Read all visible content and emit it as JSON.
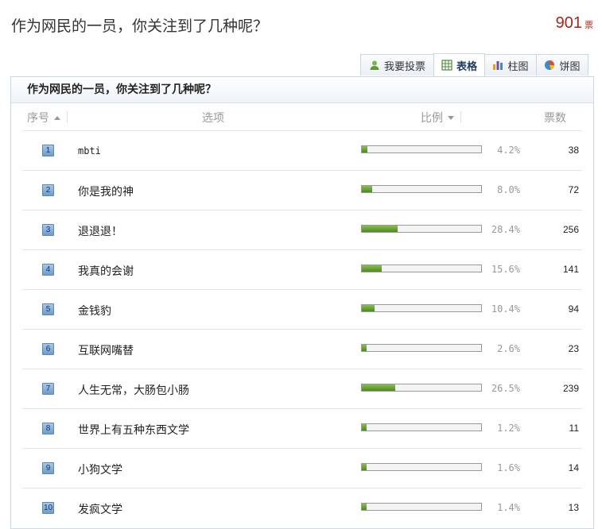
{
  "question": {
    "title": "作为网民的一员，你关注到了几种呢？",
    "total_votes": "901",
    "votes_unit": "票"
  },
  "tabs": [
    {
      "label": "我要投票",
      "icon": "user-icon",
      "active": false
    },
    {
      "label": "表格",
      "icon": "table-icon",
      "active": true
    },
    {
      "label": "柱图",
      "icon": "bar-chart-icon",
      "active": false
    },
    {
      "label": "饼图",
      "icon": "pie-chart-icon",
      "active": false
    }
  ],
  "panel": {
    "title": "作为网民的一员，你关注到了几种呢？",
    "headers": {
      "index": "序号",
      "option": "选项",
      "ratio": "比例",
      "votes": "票数"
    }
  },
  "rows": [
    {
      "index": "1",
      "option": "mbti",
      "percent": "4.2%",
      "ratio": 0.042,
      "votes": "38"
    },
    {
      "index": "2",
      "option": "你是我的神",
      "percent": "8.0%",
      "ratio": 0.08,
      "votes": "72"
    },
    {
      "index": "3",
      "option": "退退退！",
      "percent": "28.4%",
      "ratio": 0.284,
      "votes": "256"
    },
    {
      "index": "4",
      "option": "我真的会谢",
      "percent": "15.6%",
      "ratio": 0.156,
      "votes": "141"
    },
    {
      "index": "5",
      "option": "金钱豹",
      "percent": "10.4%",
      "ratio": 0.104,
      "votes": "94"
    },
    {
      "index": "6",
      "option": "互联网嘴替",
      "percent": "2.6%",
      "ratio": 0.026,
      "votes": "23"
    },
    {
      "index": "7",
      "option": "人生无常，大肠包小肠",
      "percent": "26.5%",
      "ratio": 0.265,
      "votes": "239"
    },
    {
      "index": "8",
      "option": "世界上有五种东西文学",
      "percent": "1.2%",
      "ratio": 0.012,
      "votes": "11"
    },
    {
      "index": "9",
      "option": "小狗文学",
      "percent": "1.6%",
      "ratio": 0.016,
      "votes": "14"
    },
    {
      "index": "10",
      "option": "发疯文学",
      "percent": "1.4%",
      "ratio": 0.014,
      "votes": "13"
    }
  ],
  "colors": {
    "accent": "#a8261b",
    "bar_fill": "#5f9a2c",
    "index_badge": "#7aa6d4"
  }
}
